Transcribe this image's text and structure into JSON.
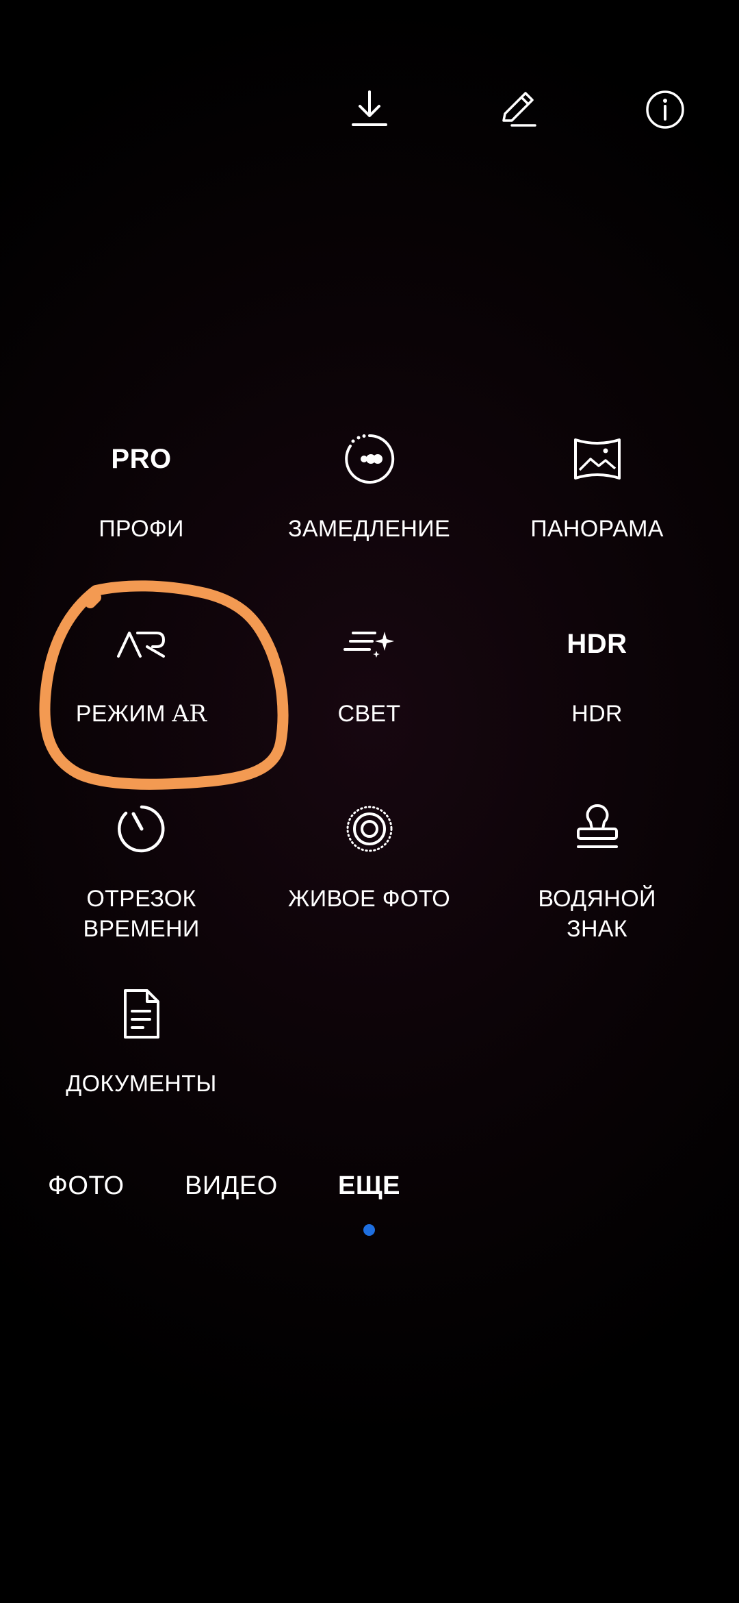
{
  "toolbar": {
    "download_icon": "download-icon",
    "edit_icon": "pencil-icon",
    "info_icon": "info-icon"
  },
  "modes": [
    {
      "id": "pro",
      "icon_text": "PRO",
      "label": "ПРОФИ"
    },
    {
      "id": "slowmo",
      "icon": "slow-motion-icon",
      "label": "ЗАМЕДЛЕНИЕ"
    },
    {
      "id": "panorama",
      "icon": "panorama-icon",
      "label": "ПАНОРАМА"
    },
    {
      "id": "ar",
      "icon_text": "AR",
      "label_main": "РЕЖИМ ",
      "label_serif": "AR"
    },
    {
      "id": "light",
      "icon": "light-painting-icon",
      "label": "СВЕТ"
    },
    {
      "id": "hdr",
      "icon_text": "HDR",
      "label_serif": "HDR"
    },
    {
      "id": "timelapse",
      "icon": "timelapse-icon",
      "label": "ОТРЕЗОК\nВРЕМЕНИ"
    },
    {
      "id": "moving",
      "icon": "moving-picture-icon",
      "label": "ЖИВОЕ ФОТО"
    },
    {
      "id": "watermark",
      "icon": "watermark-stamp-icon",
      "label": "ВОДЯНОЙ\nЗНАК"
    },
    {
      "id": "documents",
      "icon": "document-icon",
      "label": "ДОКУМЕНТЫ"
    }
  ],
  "tabs": {
    "photo": "ФОТО",
    "video": "ВИДЕО",
    "more": "ЕЩЕ",
    "active": "more"
  },
  "colors": {
    "accent": "#1e6fe0",
    "annotation": "#f39a52",
    "text": "#ffffff"
  }
}
